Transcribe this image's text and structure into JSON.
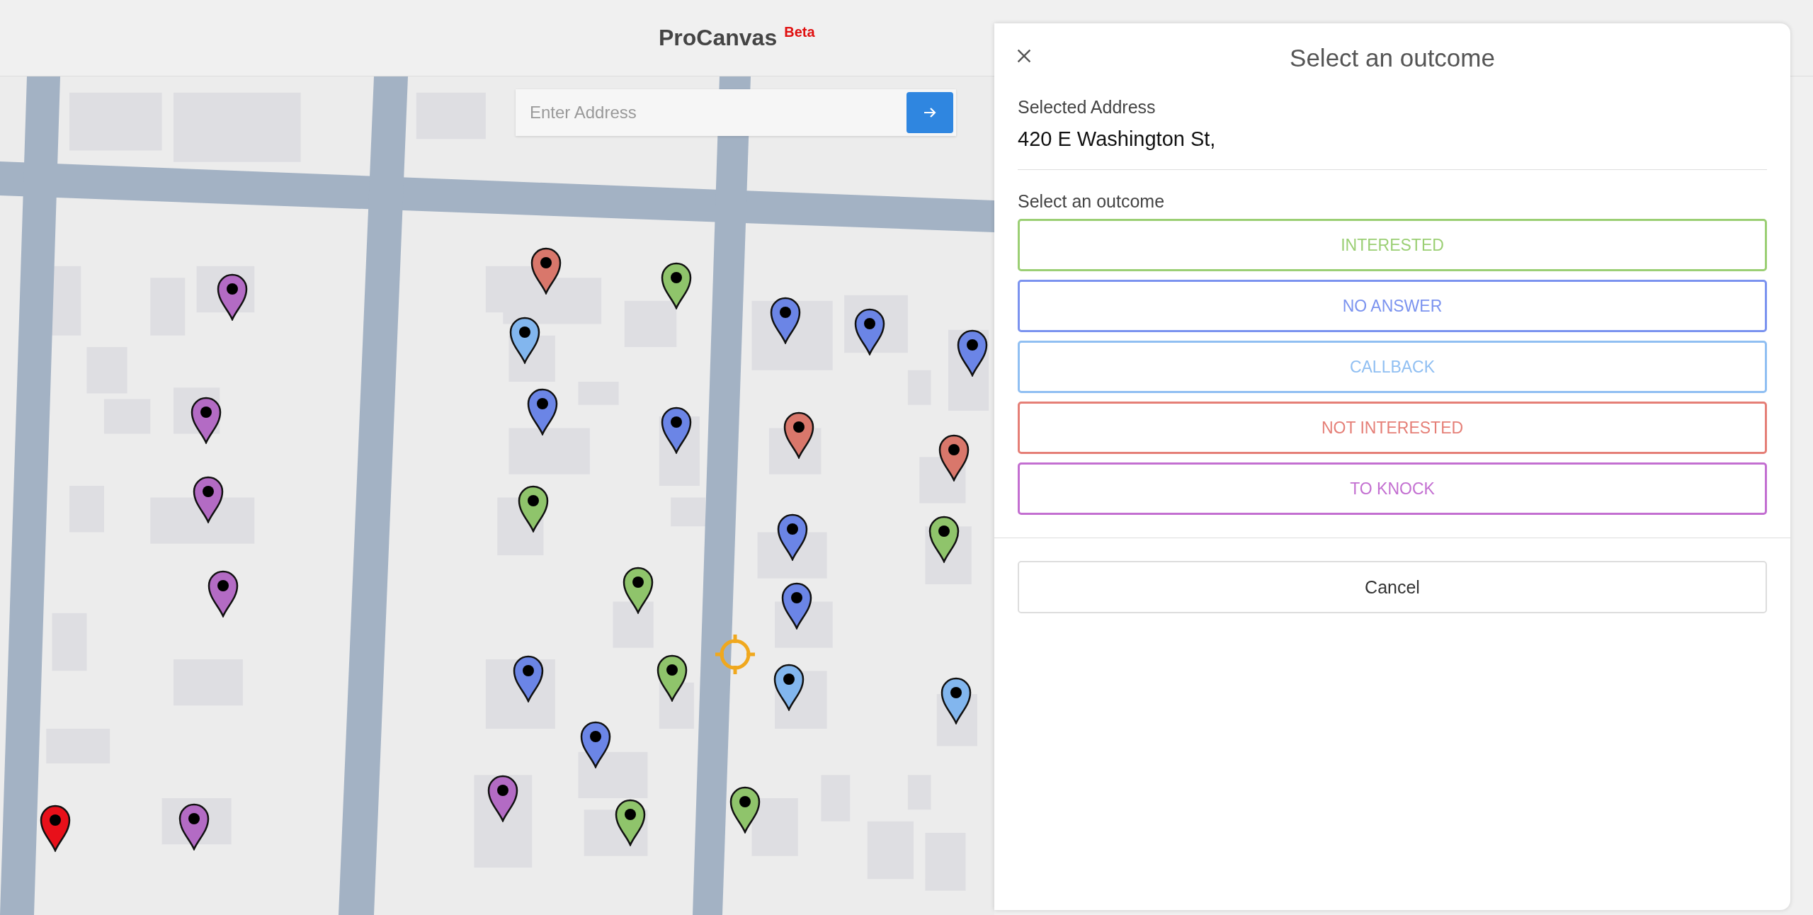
{
  "header": {
    "title": "ProCanvas",
    "badge": "Beta"
  },
  "search": {
    "placeholder": "Enter Address"
  },
  "map": {
    "kind": "picture",
    "pins": [
      {
        "color": "#b36bc4"
      },
      {
        "color": "#d9776b"
      },
      {
        "color": "#8fc46b"
      },
      {
        "color": "#82b6ee"
      },
      {
        "color": "#6b85e6"
      },
      {
        "color": "#6b85e6"
      },
      {
        "color": "#6b85e6"
      },
      {
        "color": "#b36bc4"
      },
      {
        "color": "#6b85e6"
      },
      {
        "color": "#6b85e6"
      },
      {
        "color": "#d9776b"
      },
      {
        "color": "#d9776b"
      },
      {
        "color": "#b36bc4"
      },
      {
        "color": "#8fc46b"
      },
      {
        "color": "#6b85e6"
      },
      {
        "color": "#8fc46b"
      },
      {
        "color": "#b36bc4"
      },
      {
        "color": "#8fc46b"
      },
      {
        "color": "#6b85e6"
      },
      {
        "color": "#6b85e6"
      },
      {
        "color": "#8fc46b"
      },
      {
        "color": "#82b6ee"
      },
      {
        "color": "#82b6ee"
      },
      {
        "color": "#6b85e6"
      },
      {
        "color": "#b36bc4"
      },
      {
        "color": "#8fc46b"
      },
      {
        "color": "#8fc46b"
      },
      {
        "color": "#e8101a"
      },
      {
        "color": "#b36bc4"
      }
    ]
  },
  "panel": {
    "title": "Select an outcome",
    "address_label": "Selected Address",
    "address": "420 E Washington St,",
    "outcome_label": "Select an outcome",
    "outcomes": [
      {
        "label": "INTERESTED",
        "color": "#9bcf74"
      },
      {
        "label": "NO ANSWER",
        "color": "#7b93ef"
      },
      {
        "label": "CALLBACK",
        "color": "#90bff2"
      },
      {
        "label": "NOT INTERESTED",
        "color": "#e57f77"
      },
      {
        "label": "TO KNOCK",
        "color": "#c36fd1"
      }
    ],
    "cancel": "Cancel"
  }
}
